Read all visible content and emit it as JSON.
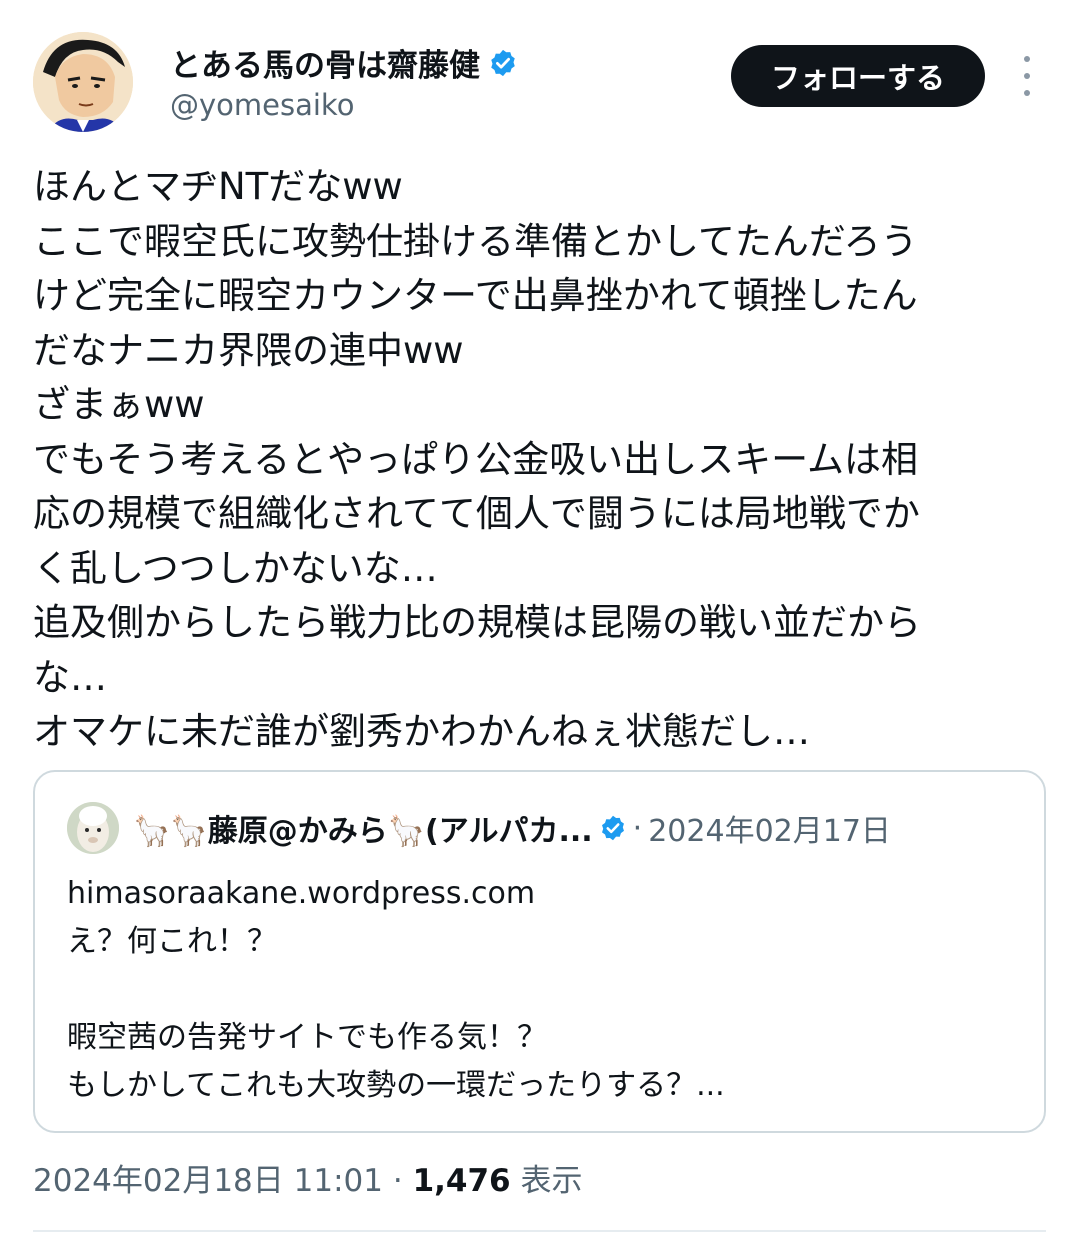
{
  "author": {
    "display_name": "とある馬の骨は齋藤健",
    "handle": "@yomesaiko",
    "verified": true,
    "verified_color": "#1d9bf0",
    "avatar": "manga-man-avatar"
  },
  "actions": {
    "follow_label": "フォローする",
    "more_icon": "more-vertical-icon"
  },
  "tweet": {
    "lines": [
      "ほんとマヂNTだなww",
      "ここで暇空氏に攻勢仕掛ける準備とかしてたんだろう",
      "けど完全に暇空カウンターで出鼻挫かれて頓挫したん",
      "だなナニカ界隈の連中ww",
      "ざまぁww",
      "でもそう考えるとやっぱり公金吸い出しスキームは相",
      "応の規模で組織化されてて個人で闘うには局地戦でか",
      "く乱しつつしかないな…",
      "追及側からしたら戦力比の規模は昆陽の戦い並だから",
      "な…",
      "オマケに未だ誰が劉秀かわかんねぇ状態だし…"
    ]
  },
  "quote": {
    "author_name": "🦙🦙藤原@かみら🦙(アルパカ...",
    "verified": true,
    "separator": "·",
    "date": "2024年02月17日",
    "avatar": "alpaca-avatar",
    "lines": [
      "himasoraakane.wordpress.com",
      "え？何これ！？",
      "",
      "暇空茜の告発サイトでも作る気！？",
      "もしかしてこれも大攻勢の一環だったりする？..."
    ]
  },
  "meta": {
    "timestamp": "2024年02月18日 11:01",
    "separator": "·",
    "views_count": "1,476",
    "views_label": "表示"
  }
}
